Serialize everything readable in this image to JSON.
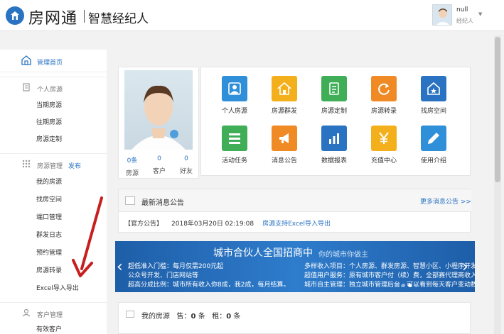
{
  "header": {
    "brand": "房网通",
    "slogan": "智慧经纪人",
    "user_name": "null",
    "user_role": "经纪人",
    "caret": "▼"
  },
  "sidebar": {
    "home_label": "管理首页",
    "sections": [
      {
        "title": "个人房源",
        "link": "",
        "items": [
          "当期房源",
          "往期房源",
          "房源定制"
        ]
      },
      {
        "title": "房源管理",
        "link": "发布",
        "items": [
          "我的房源",
          "找房空间",
          "端口管理",
          "群发日志",
          "预约管理",
          "房源转录",
          "Excel导入导出"
        ]
      },
      {
        "title": "客户管理",
        "link": "",
        "items": [
          "有效客户"
        ]
      }
    ]
  },
  "profile": {
    "stats": [
      {
        "num": "0条",
        "cap": "房源"
      },
      {
        "num": "0",
        "cap": "客户"
      },
      {
        "num": "0",
        "cap": "好友"
      }
    ]
  },
  "tiles": [
    {
      "label": "个人房源",
      "icon": "person-card-icon",
      "color": "#2f8fd8"
    },
    {
      "label": "房源群发",
      "icon": "house-icon",
      "color": "#f4b01c"
    },
    {
      "label": "房源定制",
      "icon": "document-icon",
      "color": "#3fae57"
    },
    {
      "label": "房源转录",
      "icon": "refresh-icon",
      "color": "#f08a24"
    },
    {
      "label": "找房空间",
      "icon": "star-house-icon",
      "color": "#2a73c2"
    },
    {
      "label": "活动任务",
      "icon": "list-icon",
      "color": "#3fae57"
    },
    {
      "label": "消息公告",
      "icon": "megaphone-icon",
      "color": "#f08a24"
    },
    {
      "label": "数据报表",
      "icon": "bar-chart-icon",
      "color": "#2a73c2"
    },
    {
      "label": "充值中心",
      "icon": "yen-icon",
      "color": "#f4b01c"
    },
    {
      "label": "使用介绍",
      "icon": "pencil-icon",
      "color": "#2f8fd8"
    }
  ],
  "notice": {
    "title": "最新消息公告",
    "more": "更多消息公告 >>",
    "tag": "【官方公告】",
    "date": "2018年03月20日 02:19:08",
    "link": "房源支持Excel导入导出"
  },
  "banner": {
    "title": "城市合伙人全国招商中",
    "subtitle": "你的城市你做主",
    "left_lines": [
      "超低准入门槛：每月仅需200元起",
      "公众号开发、门店网站等",
      "超高分成比例：城市所有收入你8成，我2成，每月结算。"
    ],
    "right_lines": [
      "多样收入项目：个人房源、群发房源、智慧小区、小程序开发",
      "超值用户服务：原有城市客户付（续）费，全部赛代理商收入。",
      "城市自主管理：独立城市管理后台，可以看到每天客户变动数据。"
    ]
  },
  "my_houses": {
    "title": "我的房源",
    "sale_label": "售：",
    "sale_count": "0",
    "rent_label": "租：",
    "rent_count": "0",
    "unit": "条"
  }
}
